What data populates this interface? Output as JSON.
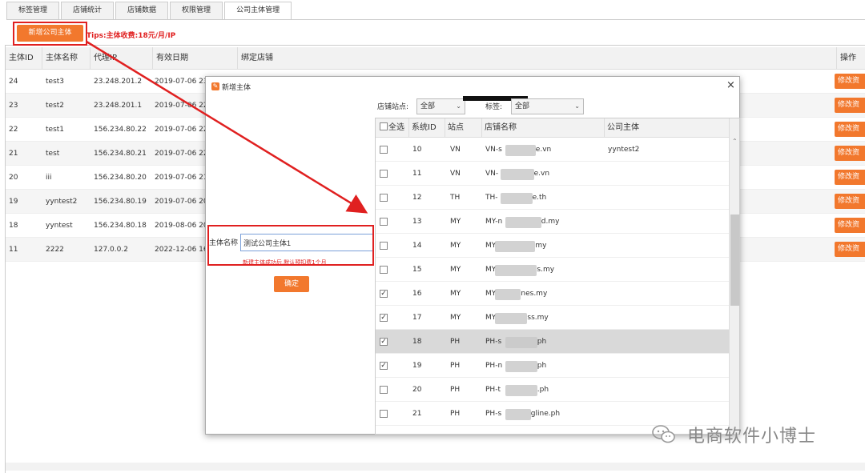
{
  "tabs": [
    "标签管理",
    "店铺统计",
    "店铺数据",
    "权限管理",
    "公司主体管理"
  ],
  "toolbar": {
    "add_label": "新增公司主体",
    "tips": "Tips:主体收费:18元/月/IP"
  },
  "table": {
    "headers": [
      "主体ID",
      "主体名称",
      "代理IP",
      "有效日期",
      "绑定店铺",
      "操作"
    ],
    "edit_label": "修改资",
    "rows": [
      {
        "id": "24",
        "name": "test3",
        "ip": "23.248.201.2",
        "date": "2019-07-06 23"
      },
      {
        "id": "23",
        "name": "test2",
        "ip": "23.248.201.1",
        "date": "2019-07-06 22"
      },
      {
        "id": "22",
        "name": "test1",
        "ip": "156.234.80.22",
        "date": "2019-07-06 22"
      },
      {
        "id": "21",
        "name": "test",
        "ip": "156.234.80.21",
        "date": "2019-07-06 22"
      },
      {
        "id": "20",
        "name": "iii",
        "ip": "156.234.80.20",
        "date": "2019-07-06 21"
      },
      {
        "id": "19",
        "name": "yyntest2",
        "ip": "156.234.80.19",
        "date": "2019-07-06 20"
      },
      {
        "id": "18",
        "name": "yyntest",
        "ip": "156.234.80.18",
        "date": "2019-08-06 20"
      },
      {
        "id": "11",
        "name": "2222",
        "ip": "127.0.0.2",
        "date": "2022-12-06 16"
      }
    ]
  },
  "dialog": {
    "title": "新增主体",
    "close": "×",
    "site_label": "店铺站点:",
    "site_value": "全部",
    "tag_label": "标签:",
    "tag_value": "全部",
    "name_label": "主体名称",
    "name_value": "测试公司主体1",
    "hint": "新建主体成功后,默认预扣费1个月",
    "ok_label": "确定",
    "grid": {
      "headers": [
        "全选",
        "系统ID",
        "站点",
        "店铺名称",
        "公司主体"
      ],
      "rows": [
        {
          "checked": false,
          "id": "10",
          "site": "VN",
          "name_l": "VN-s",
          "name_r": "e.vn",
          "company": "yyntest2",
          "selected": false
        },
        {
          "checked": false,
          "id": "11",
          "site": "VN",
          "name_l": "VN-",
          "name_r": "e.vn",
          "company": "",
          "selected": false
        },
        {
          "checked": false,
          "id": "12",
          "site": "TH",
          "name_l": "TH-",
          "name_r": "e.th",
          "company": "",
          "selected": false
        },
        {
          "checked": false,
          "id": "13",
          "site": "MY",
          "name_l": "MY-n",
          "name_r": "d.my",
          "company": "",
          "selected": false
        },
        {
          "checked": false,
          "id": "14",
          "site": "MY",
          "name_l": "MY",
          "name_r": "my",
          "company": "",
          "selected": false
        },
        {
          "checked": false,
          "id": "15",
          "site": "MY",
          "name_l": "MY",
          "name_r": "s.my",
          "company": "",
          "selected": false
        },
        {
          "checked": true,
          "id": "16",
          "site": "MY",
          "name_l": "MY",
          "name_r": "nes.my",
          "company": "",
          "selected": false
        },
        {
          "checked": true,
          "id": "17",
          "site": "MY",
          "name_l": "MY",
          "name_r": "ss.my",
          "company": "",
          "selected": false
        },
        {
          "checked": true,
          "id": "18",
          "site": "PH",
          "name_l": "PH-s",
          "name_r": "ph",
          "company": "",
          "selected": true
        },
        {
          "checked": true,
          "id": "19",
          "site": "PH",
          "name_l": "PH-n",
          "name_r": "ph",
          "company": "",
          "selected": false
        },
        {
          "checked": false,
          "id": "20",
          "site": "PH",
          "name_l": "PH-t",
          "name_r": ".ph",
          "company": "",
          "selected": false
        },
        {
          "checked": false,
          "id": "21",
          "site": "PH",
          "name_l": "PH-s",
          "name_r": "gline.ph",
          "company": "",
          "selected": false
        }
      ]
    }
  },
  "watermark": "电商软件小博士",
  "colors": {
    "accent": "#f2782d",
    "annotation": "#e02020"
  }
}
